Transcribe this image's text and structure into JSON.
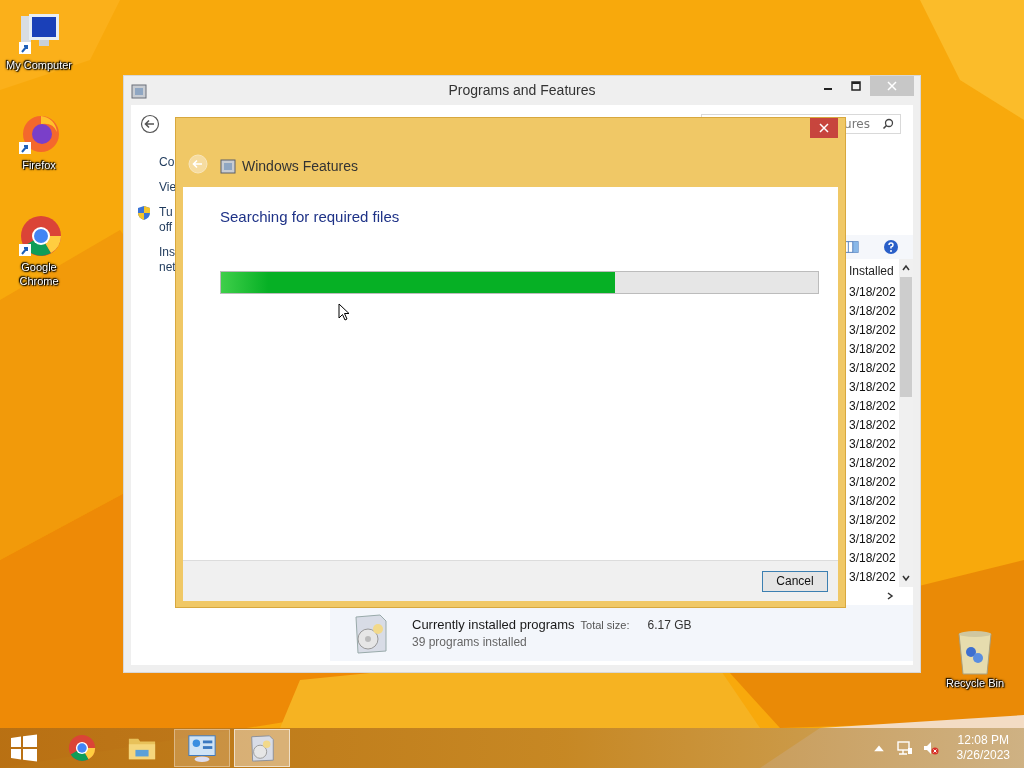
{
  "desktop_icons": [
    {
      "label": "My Computer",
      "kind": "computer"
    },
    {
      "label": "Firefox",
      "kind": "firefox"
    },
    {
      "label": "Google Chrome",
      "kind": "chrome"
    },
    {
      "label": "Recycle Bin",
      "kind": "recycle"
    }
  ],
  "programs_window": {
    "title": "Programs and Features",
    "search": {
      "value": "ures"
    },
    "left_pane": [
      {
        "lines": [
          "Co"
        ],
        "shield": false
      },
      {
        "lines": [
          "Vie"
        ],
        "shield": false
      },
      {
        "lines": [
          "Tu",
          "off"
        ],
        "shield": true
      },
      {
        "lines": [
          "Ins",
          "net"
        ],
        "shield": false
      }
    ],
    "column_header": "Installed",
    "rows": [
      "3/18/202",
      "3/18/202",
      "3/18/202",
      "3/18/202",
      "3/18/202",
      "3/18/202",
      "3/18/202",
      "3/18/202",
      "3/18/202",
      "3/18/202",
      "3/18/202",
      "3/18/202",
      "3/18/202",
      "3/18/202",
      "3/18/202",
      "3/18/202"
    ],
    "details": {
      "title": "Currently installed programs",
      "total_label": "Total size:",
      "total_value": "6.17 GB",
      "count": "39 programs installed"
    }
  },
  "dialog": {
    "title": "Windows Features",
    "status": "Searching for required files",
    "progress": {
      "level": 0.66
    },
    "buttons": [
      "Cancel"
    ]
  },
  "taskbar": {
    "apps": [
      {
        "kind": "chrome",
        "active": false,
        "selected": false
      },
      {
        "kind": "folder",
        "active": false,
        "selected": false
      },
      {
        "kind": "control_panel",
        "active": true,
        "selected": false
      },
      {
        "kind": "programs",
        "active": true,
        "selected": true
      }
    ],
    "time": "12:08 PM",
    "date": "3/26/2023"
  }
}
